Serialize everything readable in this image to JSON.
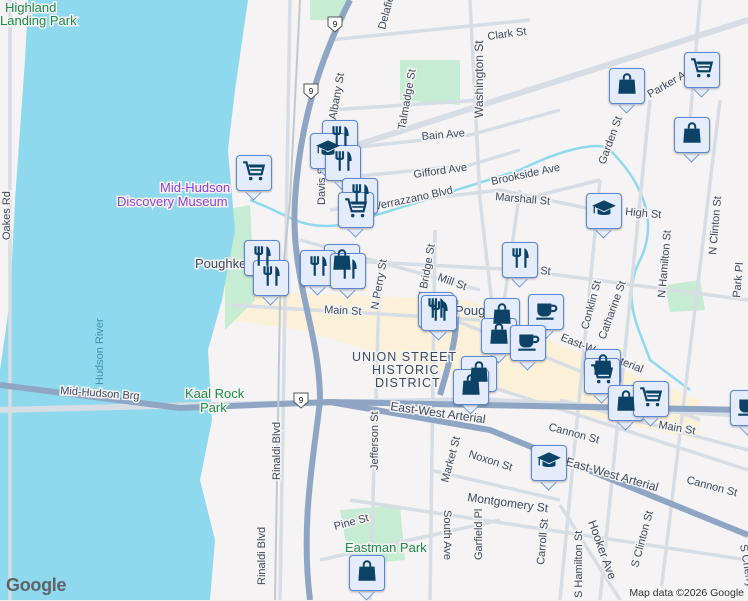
{
  "map": {
    "colors": {
      "water": "#8fd9ee",
      "land": "#f5f3f3",
      "park": "#c6ecd3",
      "highway": "#8ea6c4",
      "road": "#d7dde5",
      "district": "#fbf1d9",
      "marker_bg": "#e4ecfb",
      "marker_border": "#5a86d6",
      "icon": "#0b4266"
    },
    "labels": {
      "highland_park_1": "Highland",
      "highland_park_2": "Landing Park",
      "museum_1": "Mid-Hudson",
      "museum_2": "Discovery Museum",
      "poughkeepsie_w": "Poughke",
      "poughkeepsie_e": "Poug",
      "hudson_river": "Hudson River",
      "mid_hudson_brg": "Mid-Hudson Brg",
      "kaal_rock_1": "Kaal Rock",
      "kaal_rock_2": "Park",
      "eastman_park": "Eastman Park",
      "district_1": "UNION STREET",
      "district_2": "HISTORIC",
      "district_3": "DISTRICT",
      "oakes_rd": "Oakes Rd",
      "rinaldi_blvd": "Rinaldi Blvd",
      "jefferson_st": "Jefferson St",
      "main_st": "Main St",
      "main_st_e": "Main St",
      "n_perry_st": "N Perry St",
      "n_bridge_st": "N Bridge St",
      "mill_st": "Mill St",
      "washington_st": "Washington St",
      "clark_st": "Clark St",
      "talmadge_st": "Talmadge St",
      "bain_ave": "Bain Ave",
      "gifford_ave": "Gifford Ave",
      "brookside_ave": "Brookside Ave",
      "verrazzano_blvd": "Verrazzano Blvd",
      "marshall_st": "Marshall St",
      "garden_st": "Garden St",
      "parker_ave": "Parker Ave",
      "n_hamilton_st": "N Hamilton St",
      "n_clinton_st": "N Clinton St",
      "park_pl": "Park Pl",
      "conklin_st": "Conklin St",
      "catharine_st": "Catharine St",
      "ew_arterial_1": "East-West Arterial",
      "ew_arterial_2": "East-West Arterial",
      "ew_arterial_3": "East-West Arterial",
      "cannon_st_1": "Cannon St",
      "cannon_st_2": "Cannon St",
      "noxon_st": "Noxon St",
      "market_st": "Market St",
      "montgomery_st": "Montgomery St",
      "south_ave": "South Ave",
      "garfield_pl": "Garfield Pl",
      "carroll_st": "Carroll St",
      "s_hamilton_st": "S Hamilton St",
      "hooker_ave": "Hooker Ave",
      "s_clinton_st": "S Clinton St",
      "s_cherry_st": "S Cherry St",
      "pine_st": "Pine St",
      "davis_st": "Davis St",
      "albany_st": "Albany St",
      "delafield_st": "Delafield St",
      "high_st": "High St",
      "n_st": "St",
      "us9_a": "9",
      "us9_b": "9",
      "us9_c": "9"
    },
    "markers": [
      {
        "type": "cart"
      },
      {
        "type": "restaurant"
      },
      {
        "type": "education"
      },
      {
        "type": "restaurant"
      },
      {
        "type": "restaurant"
      },
      {
        "type": "cart"
      },
      {
        "type": "restaurant"
      },
      {
        "type": "restaurant"
      },
      {
        "type": "shop"
      },
      {
        "type": "restaurant"
      },
      {
        "type": "restaurant"
      },
      {
        "type": "restaurant"
      },
      {
        "type": "restaurant"
      },
      {
        "type": "restaurant"
      },
      {
        "type": "shop"
      },
      {
        "type": "cart"
      },
      {
        "type": "shop"
      },
      {
        "type": "education"
      },
      {
        "type": "shop"
      },
      {
        "type": "coffee"
      },
      {
        "type": "shop"
      },
      {
        "type": "coffee"
      },
      {
        "type": "shop"
      },
      {
        "type": "shop"
      },
      {
        "type": "shop"
      },
      {
        "type": "cart"
      },
      {
        "type": "shop"
      },
      {
        "type": "cart"
      },
      {
        "type": "coffee"
      },
      {
        "type": "education"
      },
      {
        "type": "shop"
      }
    ],
    "logo": "Google",
    "attribution": "Map data ©2026 Google"
  }
}
